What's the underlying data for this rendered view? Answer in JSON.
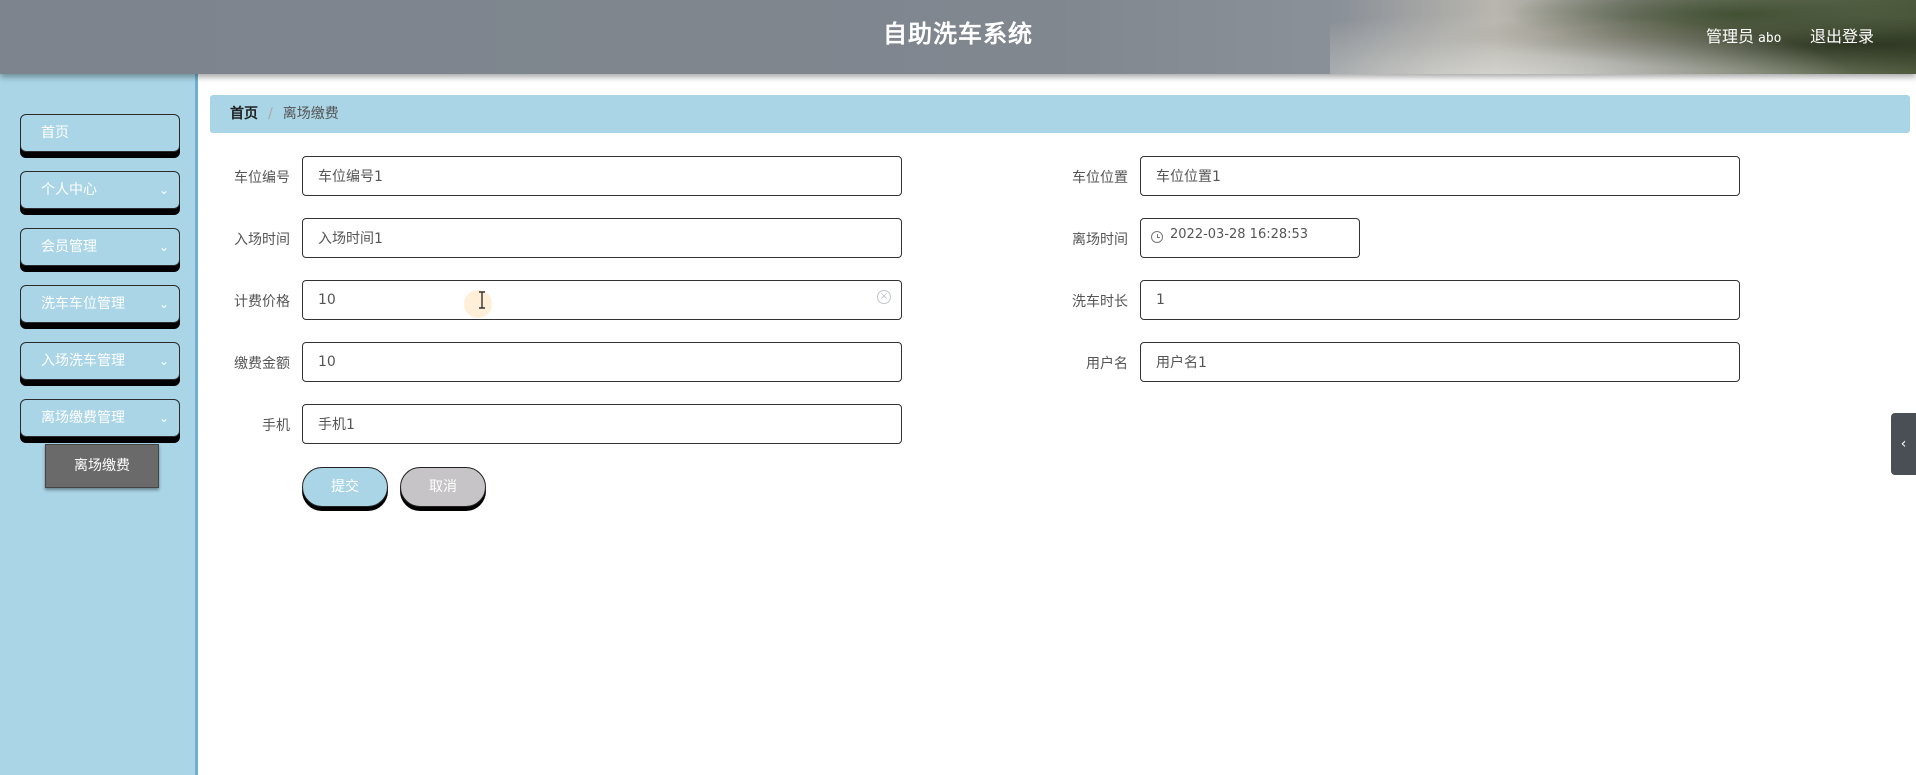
{
  "header": {
    "title": "自助洗车系统",
    "user_role": "管理员",
    "username": "abo",
    "logout_label": "退出登录"
  },
  "sidebar": {
    "items": [
      {
        "label": "首页",
        "expandable": false
      },
      {
        "label": "个人中心",
        "expandable": true
      },
      {
        "label": "会员管理",
        "expandable": true
      },
      {
        "label": "洗车车位管理",
        "expandable": true
      },
      {
        "label": "入场洗车管理",
        "expandable": true
      },
      {
        "label": "离场缴费管理",
        "expandable": true,
        "expanded": true
      }
    ],
    "sub_item": "离场缴费"
  },
  "breadcrumb": {
    "home": "首页",
    "current": "离场缴费"
  },
  "form": {
    "parking_no": {
      "label": "车位编号",
      "value": "车位编号1"
    },
    "parking_location": {
      "label": "车位位置",
      "value": "车位位置1"
    },
    "entry_time": {
      "label": "入场时间",
      "value": "入场时间1"
    },
    "exit_time": {
      "label": "离场时间",
      "value": "2022-03-28 16:28:53"
    },
    "price": {
      "label": "计费价格",
      "value": "10"
    },
    "wash_duration": {
      "label": "洗车时长",
      "value": "1"
    },
    "fee_amount": {
      "label": "缴费金额",
      "value": "10"
    },
    "username": {
      "label": "用户名",
      "value": "用户名1"
    },
    "phone": {
      "label": "手机",
      "value": "手机1"
    }
  },
  "buttons": {
    "submit": "提交",
    "cancel": "取消"
  },
  "icons": {
    "clear": "clear-circle-icon",
    "clock": "clock-icon",
    "chevron": "chevron-down-icon",
    "collapse": "chevron-left-icon"
  },
  "colors": {
    "sidebar_bg": "#a9d5e6",
    "submenu_bg": "#6a6a6a",
    "cancel_bg": "#c6c4c6"
  }
}
